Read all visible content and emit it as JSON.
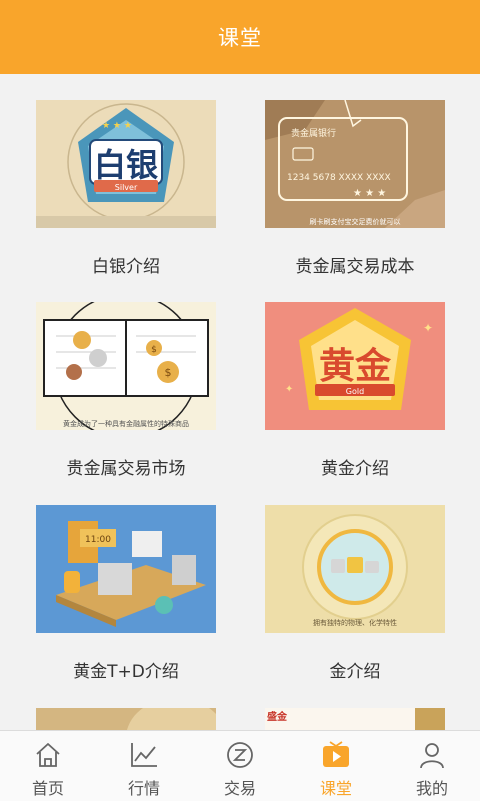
{
  "header": {
    "title": "课堂"
  },
  "lessons": [
    {
      "title": "白银介绍",
      "badge": "白银",
      "badge_sub": "Silver"
    },
    {
      "title": "贵金属交易成本",
      "card_text": "贵金属银行",
      "card_number": "1234 5678 XXXX XXXX",
      "subtitle": "刷卡刷支付宝交足费价就可以"
    },
    {
      "title": "贵金属交易市场",
      "subtitle": "黄金成为了一种具有金融属性的特殊商品"
    },
    {
      "title": "黄金介绍",
      "badge": "黄金",
      "badge_sub": "Gold"
    },
    {
      "title": "黄金T+D介绍",
      "clock": "11:00"
    },
    {
      "title": "金介绍",
      "subtitle": "拥有独特的物理、化学特性"
    },
    {
      "title": "",
      "corner_text": "盛金"
    }
  ],
  "tabbar": {
    "tabs": [
      {
        "label": "首页",
        "icon": "home-icon"
      },
      {
        "label": "行情",
        "icon": "chart-line-icon"
      },
      {
        "label": "交易",
        "icon": "trade-z-icon"
      },
      {
        "label": "课堂",
        "icon": "play-tv-icon"
      },
      {
        "label": "我的",
        "icon": "user-icon"
      }
    ]
  },
  "colors": {
    "accent": "#f9a52b",
    "background": "#f2f2f2"
  }
}
